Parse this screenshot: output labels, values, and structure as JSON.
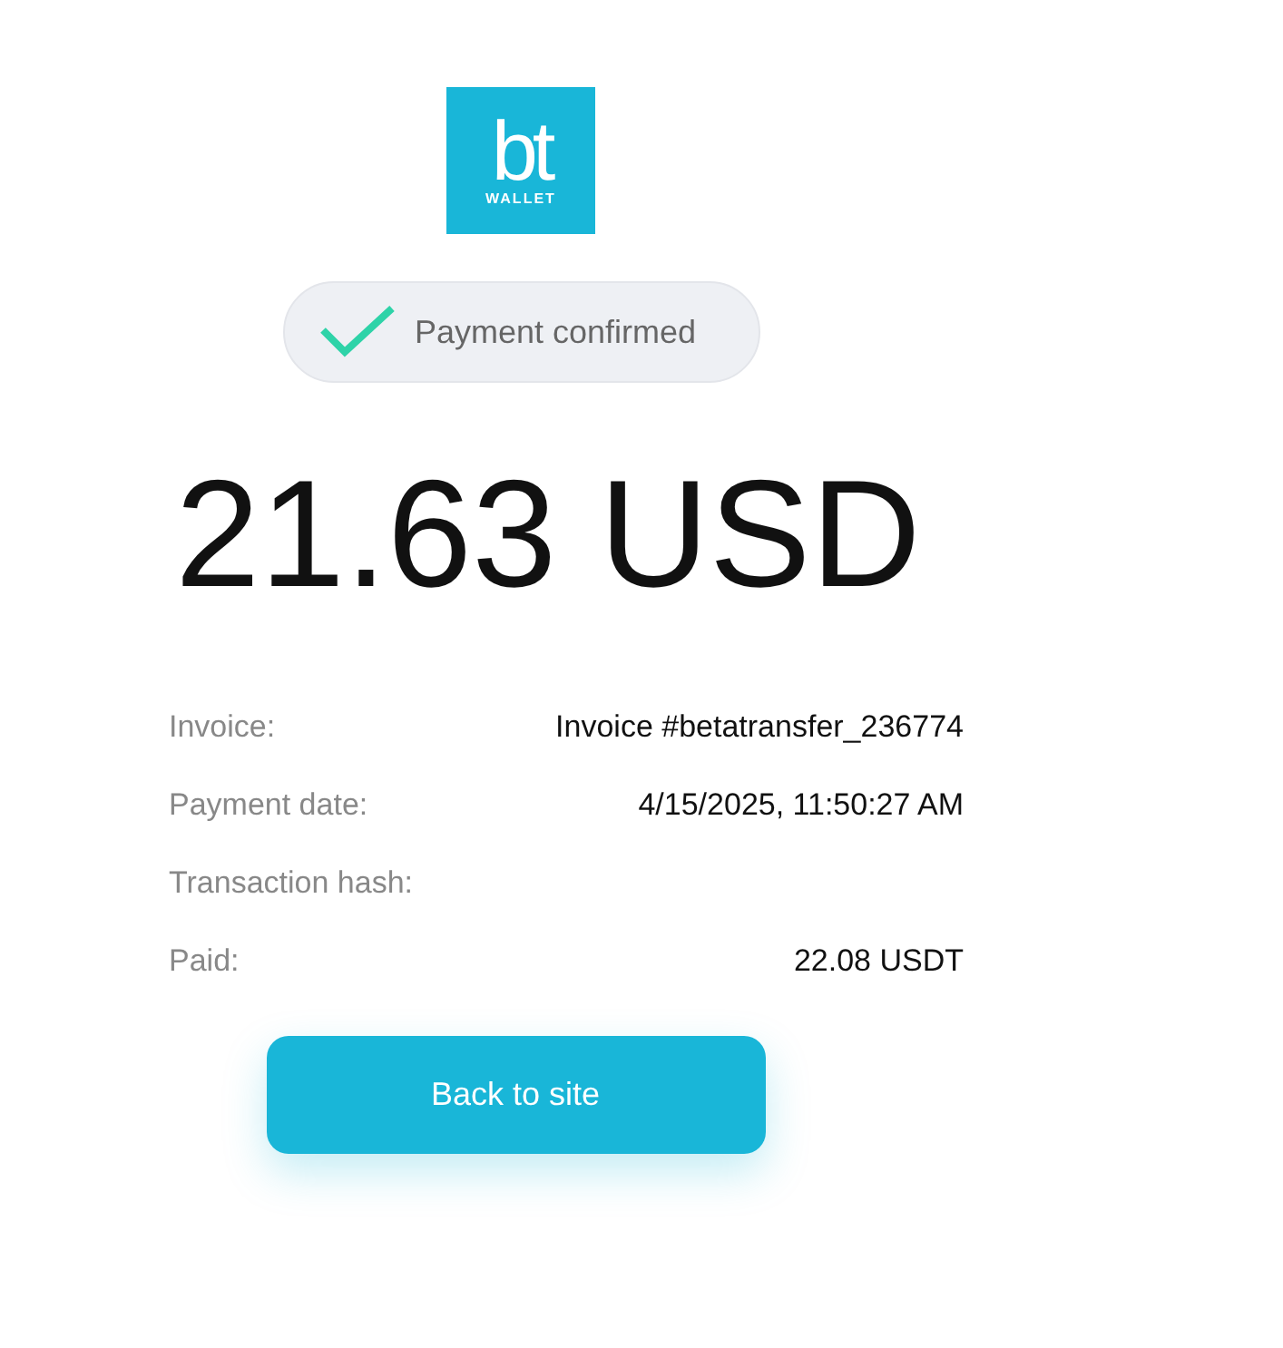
{
  "logo": {
    "mark": "bt",
    "caption": "WALLET"
  },
  "status": {
    "label": "Payment confirmed",
    "confirmed": true
  },
  "amount": "21.63 USD",
  "details": [
    {
      "label": "Invoice:",
      "value": "Invoice #betatransfer_236774"
    },
    {
      "label": "Payment date:",
      "value": "4/15/2025, 11:50:27 AM"
    },
    {
      "label": "Transaction hash:"
    },
    {
      "label": "Paid:",
      "value": "22.08 USDT"
    }
  ],
  "button": "Back to site"
}
